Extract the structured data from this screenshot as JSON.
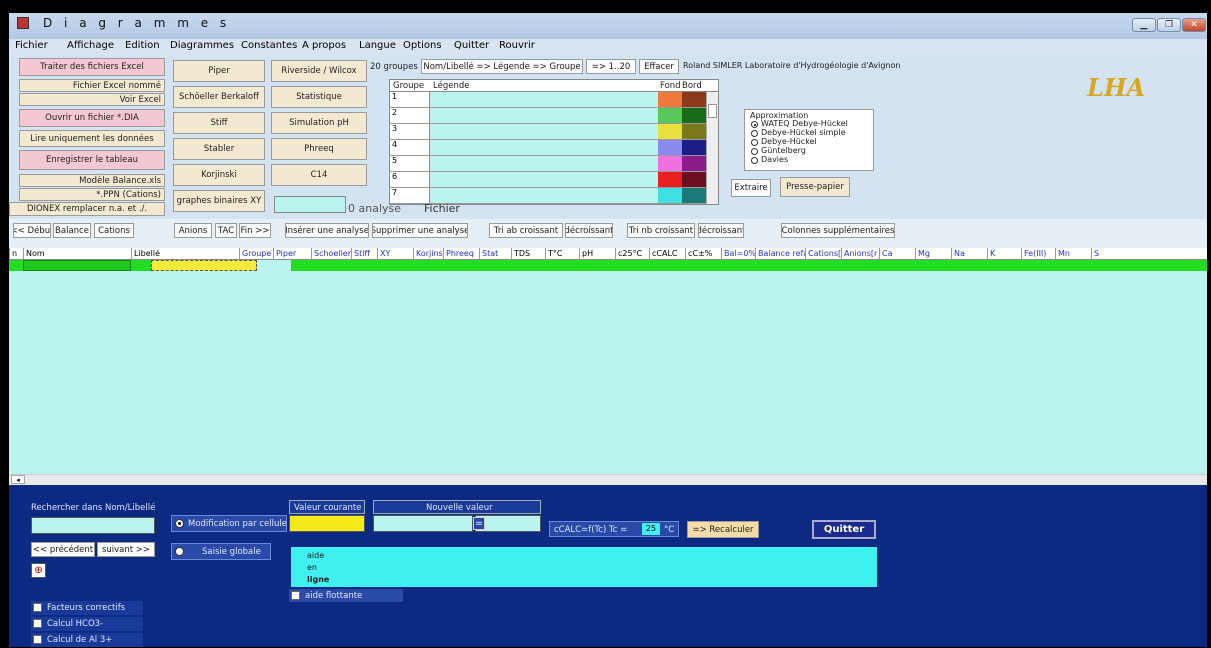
{
  "window": {
    "title": "D i a g r a m m e s"
  },
  "menu": [
    "Fichier",
    "Affichage",
    "Edition",
    "Diagrammes",
    "Constantes",
    "A propos",
    "Langue",
    "Options",
    "Quitter",
    "Rouvrir"
  ],
  "left_buttons": {
    "traiter": "Traiter des fichiers Excel",
    "fichier_excel_nomme": "Fichier Excel nommé",
    "voir_excel": "Voir Excel",
    "ouvrir_dia": "Ouvrir un fichier *.DIA",
    "lire_donnees": "Lire uniquement les données",
    "enregistrer": "Enregistrer le tableau",
    "modele_balance": "Modèle Balance.xls",
    "ppn": "*.PPN (Cations)",
    "dionex": "DIONEX remplacer n.a. et ./."
  },
  "diagram_buttons": {
    "piper": "Piper",
    "schoeller": "Schöeller Berkaloff",
    "stiff": "Stiff",
    "stabler": "Stabler",
    "korjinski": "Korjinski",
    "graphes": "graphes binaires XY",
    "riverside": "Riverside / Wilcox",
    "statistique": "Statistique",
    "simulation": "Simulation pH",
    "phreeq": "Phreeq",
    "c14": "C14"
  },
  "groups": {
    "label": "20 groupes",
    "nom_libelle": "Nom/Libellé => Légende => Groupe",
    "range": "=> 1..20",
    "effacer": "Effacer",
    "author": "Roland SIMLER Laboratoire d'Hydrogéologie d'Avignon",
    "col_groupe": "Groupe",
    "col_legende": "Légende",
    "col_fond": "Fond",
    "col_bord": "Bord",
    "rows": [
      {
        "n": "1",
        "fond": "#f07a3c",
        "bord": "#8b3a1c"
      },
      {
        "n": "2",
        "fond": "#58c858",
        "bord": "#1a6a1a"
      },
      {
        "n": "3",
        "fond": "#e8e040",
        "bord": "#7a7a1a"
      },
      {
        "n": "4",
        "fond": "#8a8af0",
        "bord": "#1c1c8b"
      },
      {
        "n": "5",
        "fond": "#f070e0",
        "bord": "#8b1a8b"
      },
      {
        "n": "6",
        "fond": "#e82020",
        "bord": "#6a1020"
      },
      {
        "n": "7",
        "fond": "#40e0e0",
        "bord": "#1a7a7a"
      }
    ]
  },
  "approximation": {
    "title": "Approximation",
    "options": [
      "WATEQ Debye-Hückel",
      "Debye-Hückel simple",
      "Debye-Hückel",
      "Güntelberg",
      "Davies"
    ],
    "selected": "WATEQ Debye-Hückel"
  },
  "extraire": "Extraire",
  "presse_papier": "Presse-papier",
  "logo": "LHA",
  "analyse_count": "0 analyse",
  "fichier": "Fichier",
  "nav": {
    "debut": "<< Début",
    "balance": "Balance",
    "cations": "Cations",
    "anions": "Anions",
    "tac": "TAC",
    "fin": "Fin >>",
    "inserer": "Insérer une analyse",
    "supprimer": "Supprimer une analyse",
    "tri_ab": "Tri ab croissant",
    "decroissant1": "décroissant",
    "tri_nb": "Tri nb croissant",
    "decroissant2": "décroissant",
    "colonnes": "Colonnes supplémentaires"
  },
  "columns": [
    "n",
    "Nom",
    "Libellé",
    "Groupe",
    "Piper",
    "Schoeller",
    "Stiff",
    "XY",
    "Korjinski",
    "Phreeq",
    "Stat",
    "TDS",
    "T°C",
    "pH",
    "c25°C",
    "cCALC",
    "cC±%",
    "Bal=0%",
    "Balance refaire",
    "Cations[",
    "Anions[r",
    "Ca",
    "Mg",
    "Na",
    "K",
    "Fe(III)",
    "Mn",
    "S"
  ],
  "bottom": {
    "rechercher": "Rechercher dans Nom/Libellé",
    "precedent": "<< précédent",
    "suivant": "suivant >>",
    "modification": "Modification par cellule",
    "saisie": "Saisie globale",
    "valeur_courante": "Valeur courante",
    "nouvelle_valeur": "Nouvelle valeur",
    "equals": "=",
    "ccalc": "cCALC=f(Tc)  Tc =",
    "tc_value": "25",
    "unit": "°C",
    "recalculer": "=> Recalculer",
    "quitter": "Quitter",
    "aide1": "aide",
    "aide2": "en",
    "aide3": "ligne",
    "aide_flottante": "aide flottante",
    "facteurs": "Facteurs correctifs",
    "hco3": "Calcul HCO3-",
    "al3": "Calcul de Al 3+"
  }
}
